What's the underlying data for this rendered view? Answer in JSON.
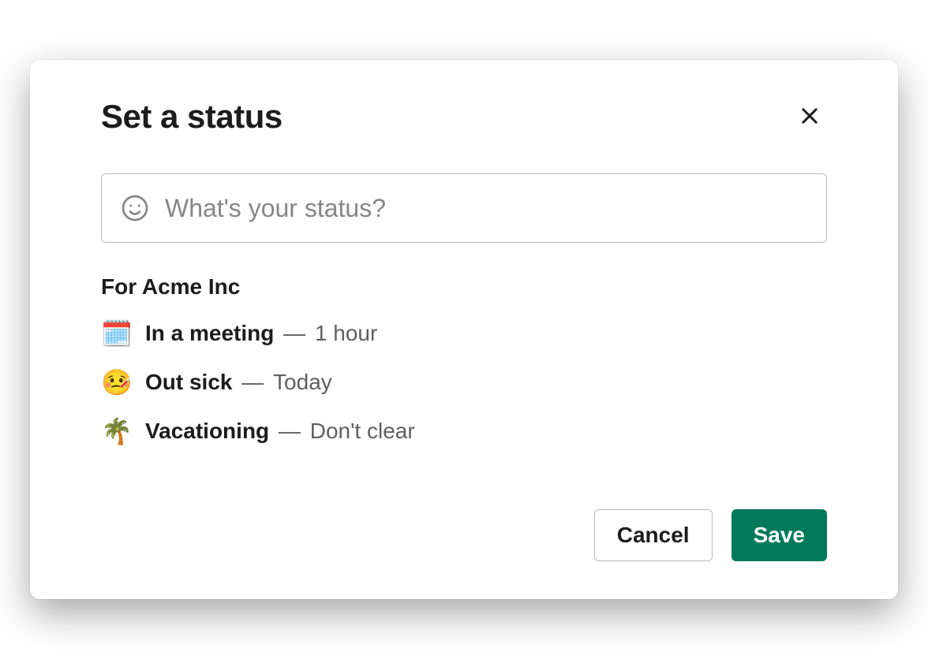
{
  "modal": {
    "title": "Set a status",
    "input": {
      "placeholder": "What's your status?",
      "value": ""
    },
    "workspace_label": "For Acme Inc",
    "presets": [
      {
        "emoji": "🗓️",
        "label": "In a meeting",
        "separator": " — ",
        "duration": "1 hour"
      },
      {
        "emoji": "🤒",
        "label": "Out sick",
        "separator": " — ",
        "duration": "Today"
      },
      {
        "emoji": "🌴",
        "label": "Vacationing",
        "separator": " — ",
        "duration": "Don't clear"
      }
    ],
    "buttons": {
      "cancel": "Cancel",
      "save": "Save"
    }
  }
}
